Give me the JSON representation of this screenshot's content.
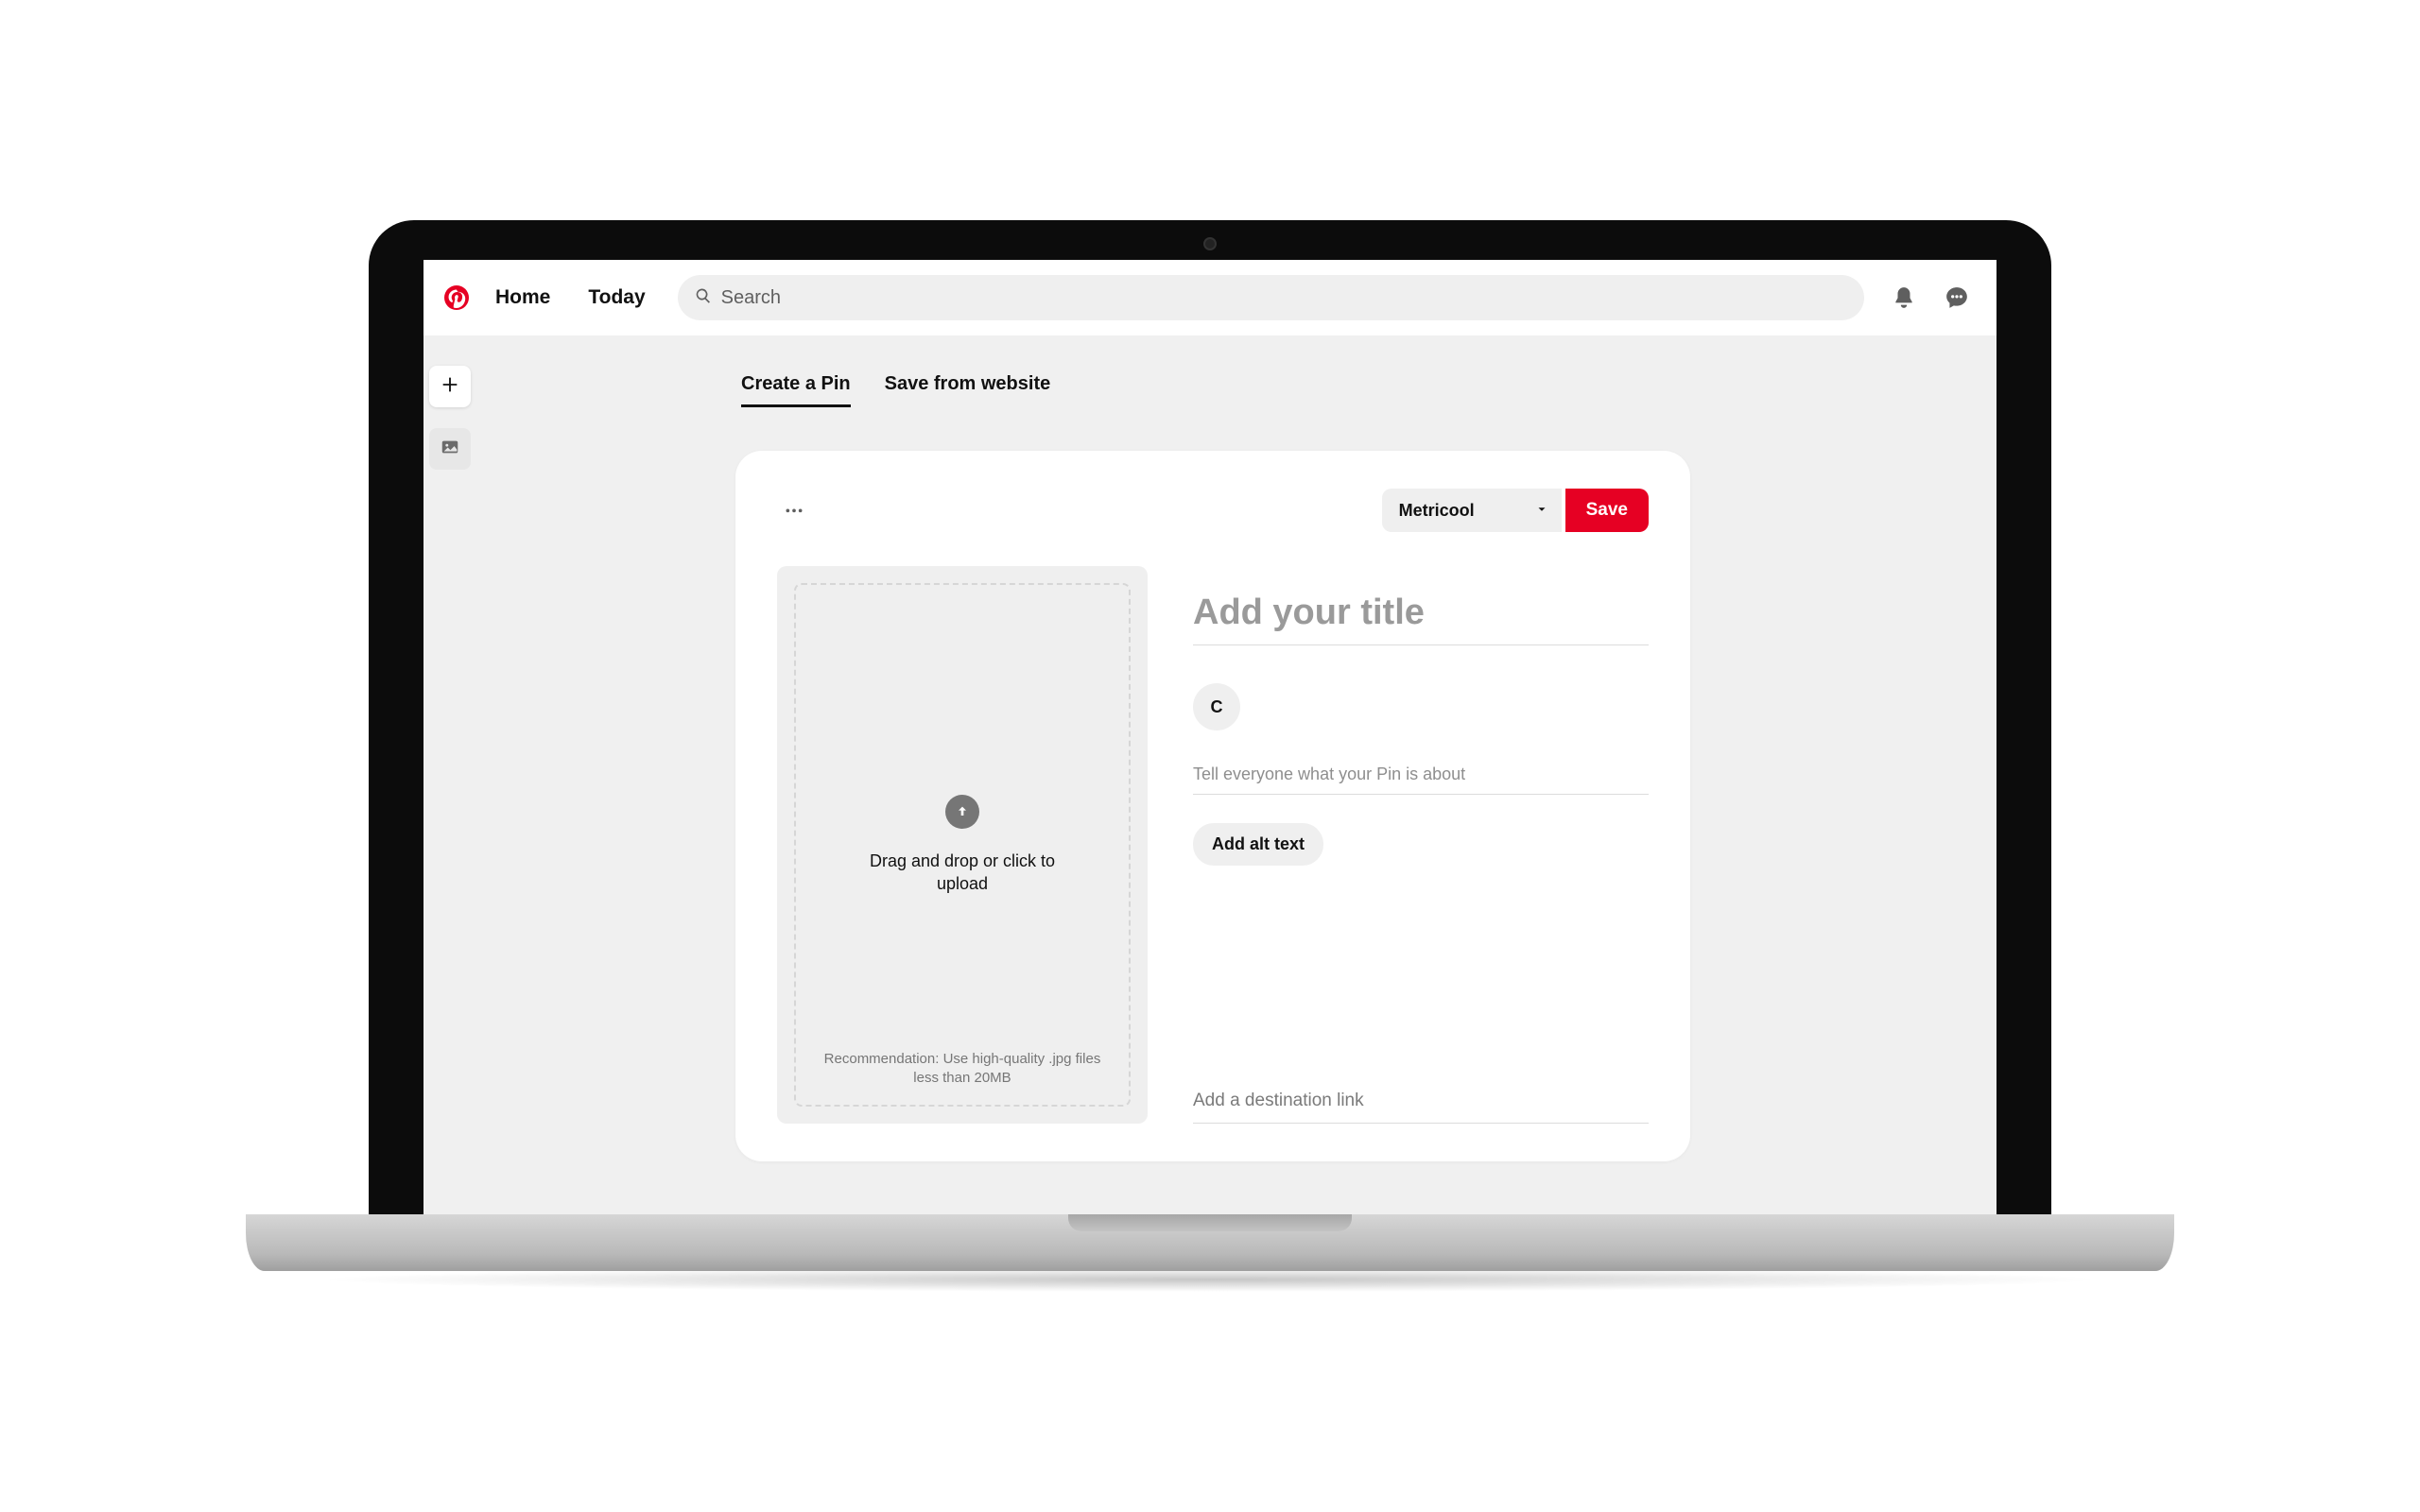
{
  "nav": {
    "home": "Home",
    "today": "Today",
    "search_placeholder": "Search"
  },
  "tabs": {
    "create": "Create a Pin",
    "save_web": "Save from website"
  },
  "builder": {
    "board_selected": "Metricool",
    "save_label": "Save",
    "drop_text": "Drag and drop or click to upload",
    "drop_recommendation": "Recommendation: Use high-quality .jpg files less than 20MB",
    "title_placeholder": "Add your title",
    "avatar_initial": "C",
    "desc_placeholder": "Tell everyone what your Pin is about",
    "alt_text_label": "Add alt text",
    "link_placeholder": "Add a destination link"
  },
  "colors": {
    "brand": "#e60023"
  }
}
